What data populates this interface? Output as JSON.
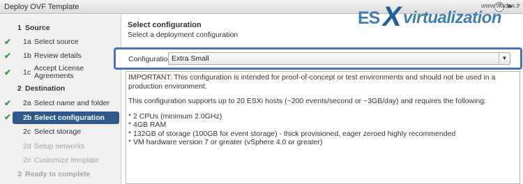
{
  "window": {
    "title": "Deploy OVF Template",
    "help_symbol": "?",
    "expand_symbol": "▸▸"
  },
  "sidebar": {
    "steps": [
      {
        "num": "1",
        "label": "Source",
        "kind": "section",
        "checked": false
      },
      {
        "num": "1a",
        "label": "Select source",
        "kind": "sub",
        "checked": true
      },
      {
        "num": "1b",
        "label": "Review details",
        "kind": "sub",
        "checked": true
      },
      {
        "num": "1c",
        "label": "Accept License Agreements",
        "kind": "sub",
        "checked": true
      },
      {
        "num": "2",
        "label": "Destination",
        "kind": "section",
        "checked": false
      },
      {
        "num": "2a",
        "label": "Select name and folder",
        "kind": "sub",
        "checked": true
      },
      {
        "num": "2b",
        "label": "Select configuration",
        "kind": "sub",
        "checked": true,
        "active": true
      },
      {
        "num": "2c",
        "label": "Select storage",
        "kind": "sub",
        "checked": false
      },
      {
        "num": "2d",
        "label": "Setup networks",
        "kind": "sub",
        "checked": false,
        "disabled": true
      },
      {
        "num": "2e",
        "label": "Customize template",
        "kind": "sub",
        "checked": false,
        "disabled": true
      },
      {
        "num": "3",
        "label": "Ready to complete",
        "kind": "section",
        "checked": false,
        "disabled": true
      }
    ],
    "check_icon": "checkmark-icon",
    "check_color": "#3a9a3a",
    "active_color": "#2d5a8a"
  },
  "main": {
    "heading": "Select configuration",
    "subheading": "Select a deployment configuration",
    "config_label": "Configuration:",
    "config_value": "Extra Small",
    "highlight_color": "#4472c4",
    "description": {
      "important": "IMPORTANT: This configuration is intended for proof-of-concept or test environments and should not be used in a production environment.",
      "supports": "This configuration supports up to 20 ESXi hosts (~200 events/second or ~3GB/day) and requires the following:",
      "req1": "* 2 CPUs (minimum 2.0GHz)",
      "req2": "* 4GB RAM",
      "req3": "* 132GB of storage (100GB for event storage) - thick provisioned, eager zeroed highly recommended",
      "req4": "* VM hardware version 7 or greater (vSphere 4.0 or greater)"
    }
  },
  "watermark": {
    "site": "www.vladan.fr",
    "es": "ES",
    "x": "X",
    "virtualization": "virtualization"
  }
}
